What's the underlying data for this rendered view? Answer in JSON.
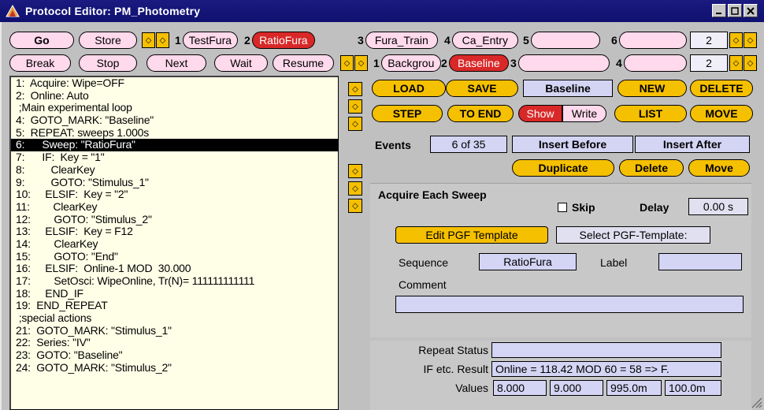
{
  "window": {
    "title": "Protocol Editor:  PM_Photometry",
    "controls": [
      "_",
      "□",
      "×"
    ],
    "colors": {
      "titlebar": "#101070",
      "accent_yellow": "#f5c000",
      "pink": "#ffd9ec",
      "red": "#d82828",
      "lavender": "#d4d4f4",
      "code_bg": "#ffffe8"
    }
  },
  "row1": {
    "go": "Go",
    "store": "Store",
    "sequences": [
      {
        "num": "1",
        "label": "TestFura"
      },
      {
        "num": "2",
        "label": "RatioFura",
        "active": true
      },
      {
        "num": "3",
        "label": "Fura_Train"
      },
      {
        "num": "4",
        "label": "Ca_Entry"
      },
      {
        "num": "5",
        "label": ""
      },
      {
        "num": "6",
        "label": ""
      }
    ],
    "page": "2"
  },
  "row2": {
    "buttons": [
      "Break",
      "Stop",
      "Next",
      "Wait",
      "Resume"
    ],
    "protocols": [
      {
        "num": "1",
        "label": "Backgrou"
      },
      {
        "num": "2",
        "label": "Baseline",
        "active": true
      },
      {
        "num": "3",
        "label": ""
      },
      {
        "num": "4",
        "label": ""
      }
    ],
    "page": "2"
  },
  "code": {
    "lines": [
      "1:  Acquire: Wipe=OFF",
      "2:  Online: Auto",
      " ;Main experimental loop",
      "4:  GOTO_MARK: \"Baseline\"",
      "5:  REPEAT: sweeps 1.000s",
      "6:      Sweep: \"RatioFura\"",
      "7:      IF:  Key = \"1\"",
      "8:         ClearKey",
      "9:         GOTO: \"Stimulus_1\"",
      "10:     ELSIF:  Key = \"2\"",
      "11:        ClearKey",
      "12:        GOTO: \"Stimulus_2\"",
      "13:     ELSIF:  Key = F12",
      "14:        ClearKey",
      "15:        GOTO: \"End\"",
      "16:     ELSIF:  Online-1 MOD  30.000",
      "17:        SetOsci: WipeOnline, Tr(N)= 111111111111",
      "18:     END_IF",
      "19:  END_REPEAT",
      " ;special actions",
      "21:  GOTO_MARK: \"Stimulus_1\"",
      "22:  Series: \"IV\"",
      "23:  GOTO: \"Baseline\"",
      "24:  GOTO_MARK: \"Stimulus_2\""
    ],
    "selected_index": 5
  },
  "toolbar": {
    "load": "LOAD",
    "save": "SAVE",
    "name": "Baseline",
    "new": "NEW",
    "delete": "DELETE",
    "step": "STEP",
    "to_end": "TO END",
    "show": "Show",
    "write": "Write",
    "list": "LIST",
    "move": "MOVE"
  },
  "events": {
    "label": "Events",
    "value": "6 of 35",
    "insert_before": "Insert Before",
    "insert_after": "Insert After",
    "duplicate": "Duplicate",
    "delete": "Delete",
    "move": "Move"
  },
  "sweep": {
    "heading": "Acquire Each Sweep",
    "skip": "Skip",
    "delay_label": "Delay",
    "delay_value": "0.00 s",
    "edit_pgf": "Edit PGF Template",
    "select_pgf": "Select PGF-Template:",
    "sequence_label": "Sequence",
    "sequence_value": "RatioFura",
    "label_label": "Label",
    "label_value": "",
    "comment_label": "Comment",
    "comment_value": ""
  },
  "status": {
    "repeat_label": "Repeat Status",
    "repeat_value": "",
    "if_label": "IF etc. Result",
    "if_value": "Online =  118.42  MOD 60 = 58 => F.",
    "values_label": "Values",
    "values": [
      "8.000",
      "9.000",
      "995.0m",
      "100.0m"
    ]
  }
}
